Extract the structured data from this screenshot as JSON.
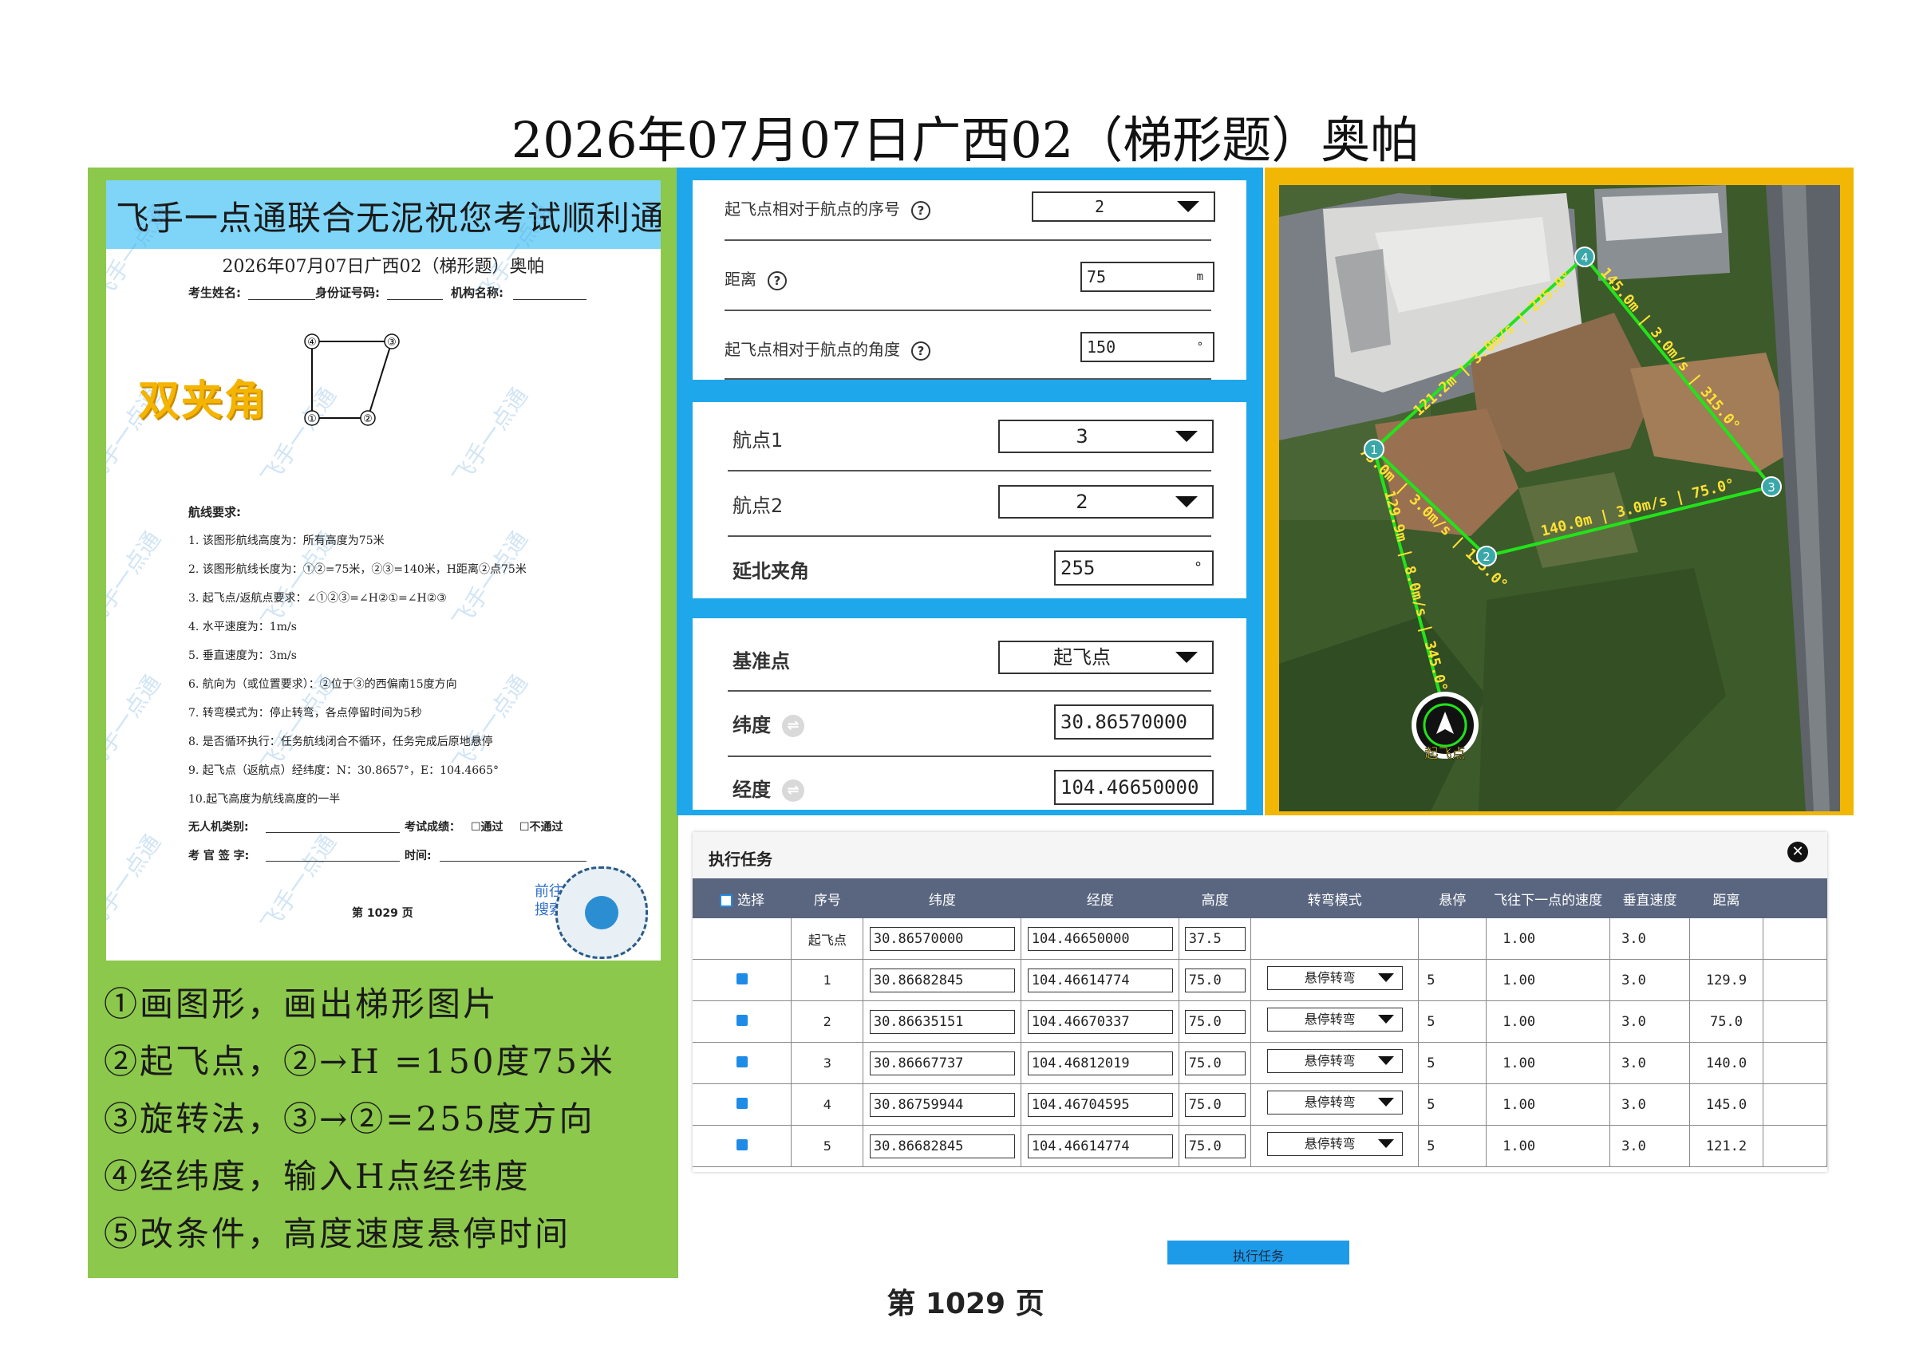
{
  "page_title": "2026年07月07日广西02（梯形题）奥帕",
  "sheet": {
    "banner": "飞手一点通联合无泥祝您考试顺利通过",
    "title": "2026年07月07日广西02（梯形题）奥帕",
    "fields": {
      "name": "考生姓名:",
      "id": "身份证号码:",
      "org": "机构名称:"
    },
    "shape_label": "双夹角",
    "points": [
      "④",
      "③",
      "①",
      "②"
    ],
    "req_title": "航线要求:",
    "requirements": [
      "1. 该图形航线高度为：所有高度为75米",
      "2. 该图形航线长度为：①②=75米，②③=140米，H距离②点75米",
      "3. 起飞点/返航点要求：∠①②③=∠H②①=∠H②③",
      "4. 水平速度为：1m/s",
      "5. 垂直速度为：3m/s",
      "6. 航向为（或位置要求）：②位于③的西偏南15度方向",
      "7. 转弯模式为：停止转弯，各点停留时间为5秒",
      "8. 是否循环执行：任务航线闭合不循环，任务完成后原地悬停",
      "9. 起飞点（返航点）经纬度：N：30.8657°，E：104.4665°",
      "10.起飞高度为航线高度的一半"
    ],
    "uav_type": "无人机类别:",
    "result": "考试成绩：",
    "pass": "☐通过",
    "fail": "☐不通过",
    "examiner": "考 官 签 字:",
    "time": "时间:",
    "promo_line1": "前往飞手一点通",
    "promo_line2": "搜索题目看答案",
    "page": "第 1029 页",
    "watermark": "飞手一点通"
  },
  "steps": [
    "①画图形，画出梯形图片",
    "②起飞点，②→H =150度75米",
    "③旋转法，③→②=255度方向",
    "④经纬度，输入H点经纬度",
    "⑤改条件，高度速度悬停时间"
  ],
  "takeoff_card": {
    "seq_label": "起飞点相对于航点的序号",
    "seq_value": "2",
    "dist_label": "距离",
    "dist_value": "75",
    "dist_unit": "m",
    "angle_label": "起飞点相对于航点的角度",
    "angle_value": "150",
    "angle_unit": "°",
    "help_glyph": "?"
  },
  "rotate_card": {
    "wp1_label": "航点1",
    "wp1_value": "3",
    "wp2_label": "航点2",
    "wp2_value": "2",
    "angle_label": "延北夹角",
    "angle_value": "255",
    "angle_unit": "°"
  },
  "ref_card": {
    "ref_label": "基准点",
    "ref_value": "起飞点",
    "lat_label": "纬度",
    "lat_value": "30.86570000",
    "lng_label": "经度",
    "lng_value": "104.46650000",
    "dim_glyph": "⇌"
  },
  "map": {
    "waypoints": [
      "1",
      "2",
      "3",
      "4"
    ],
    "segment_labels": [
      "121.2m | 3.0m/s | 225.0°",
      "145.0m | 3.0m/s | 315.0°",
      "140.0m | 3.0m/s | 75.0°",
      "75.0m | 3.0m/s | 135.0°",
      "129.9m | 8.0m/s | 345.0°"
    ],
    "home_label": "起飞点",
    "colors": {
      "route": "#22e31a",
      "waypoint": "#3aa7a8",
      "label": "#ffe233"
    }
  },
  "task": {
    "title": "执行任务",
    "close_glyph": "✕",
    "columns": [
      "选择",
      "序号",
      "纬度",
      "经度",
      "高度",
      "转弯模式",
      "悬停",
      "飞往下一点的速度",
      "垂直速度",
      "距离"
    ],
    "rows": [
      {
        "seq": "起飞点",
        "lat": "30.86570000",
        "lng": "104.46650000",
        "alt": "37.5",
        "turn": "",
        "hover": "",
        "speed": "1.00",
        "vspeed": "3.0",
        "dist": ""
      },
      {
        "seq": "1",
        "lat": "30.86682845",
        "lng": "104.46614774",
        "alt": "75.0",
        "turn": "悬停转弯",
        "hover": "5",
        "speed": "1.00",
        "vspeed": "3.0",
        "dist": "129.9"
      },
      {
        "seq": "2",
        "lat": "30.86635151",
        "lng": "104.46670337",
        "alt": "75.0",
        "turn": "悬停转弯",
        "hover": "5",
        "speed": "1.00",
        "vspeed": "3.0",
        "dist": "75.0"
      },
      {
        "seq": "3",
        "lat": "30.86667737",
        "lng": "104.46812019",
        "alt": "75.0",
        "turn": "悬停转弯",
        "hover": "5",
        "speed": "1.00",
        "vspeed": "3.0",
        "dist": "140.0"
      },
      {
        "seq": "4",
        "lat": "30.86759944",
        "lng": "104.46704595",
        "alt": "75.0",
        "turn": "悬停转弯",
        "hover": "5",
        "speed": "1.00",
        "vspeed": "3.0",
        "dist": "145.0"
      },
      {
        "seq": "5",
        "lat": "30.86682845",
        "lng": "104.46614774",
        "alt": "75.0",
        "turn": "悬停转弯",
        "hover": "5",
        "speed": "1.00",
        "vspeed": "3.0",
        "dist": "121.2"
      }
    ],
    "execute_label": "执行任务"
  },
  "page_number": "第 1029 页"
}
